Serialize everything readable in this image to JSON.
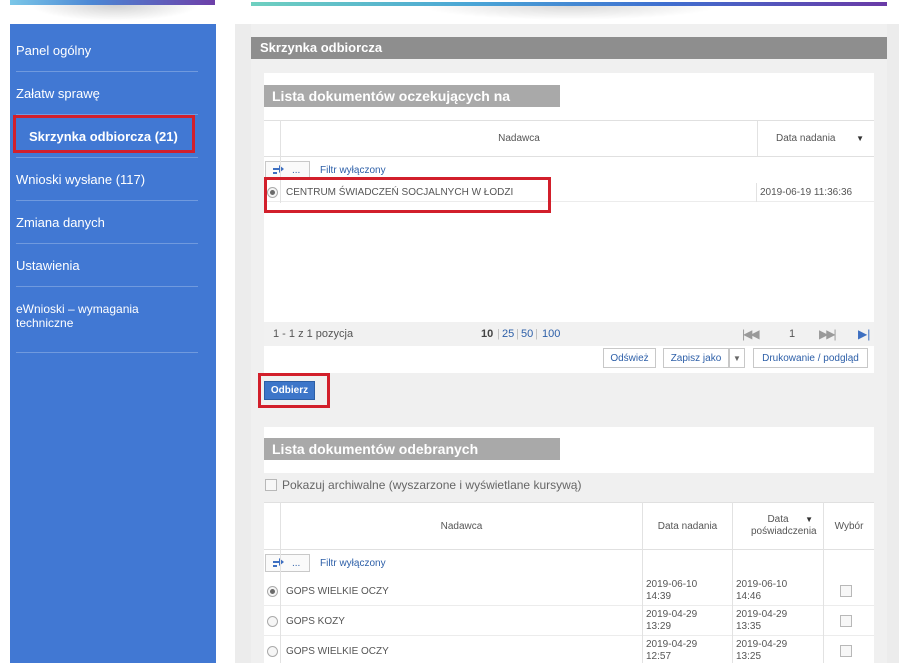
{
  "sidebar": {
    "items": [
      {
        "label": "Panel ogólny"
      },
      {
        "label": "Załatw sprawę"
      },
      {
        "label": "Skrzynka odbiorcza (21)"
      },
      {
        "label": "Wnioski wysłane (117)"
      },
      {
        "label": "Zmiana danych"
      },
      {
        "label": "Ustawienia"
      },
      {
        "label": "eWnioski – wymagania techniczne"
      }
    ]
  },
  "page": {
    "title": "Skrzynka odbiorcza"
  },
  "pending": {
    "title": "Lista dokumentów oczekujących na odbiór",
    "columns": {
      "sender": "Nadawca",
      "date": "Data nadania"
    },
    "filter_label": "Filtr wyłączony",
    "filter_button": "...",
    "rows": [
      {
        "sender": "CENTRUM ŚWIADCZEŃ SOCJALNYCH W ŁODZI",
        "date": "2019-06-19 11:36:36",
        "selected": true
      }
    ],
    "pager": {
      "summary": "1 - 1 z 1 pozycja",
      "sizes": [
        "10",
        "25",
        "50",
        "100"
      ],
      "current_page": "1"
    },
    "actions": {
      "refresh": "Odśwież",
      "save_as": "Zapisz jako",
      "print": "Drukowanie / podgląd"
    },
    "receive_button": "Odbierz"
  },
  "received": {
    "title": "Lista dokumentów odebranych",
    "archive_checkbox_label": "Pokazuj archiwalne (wyszarzone i wyświetlane kursywą)",
    "columns": {
      "sender": "Nadawca",
      "date": "Data nadania",
      "confirm_date": "Data poświadczenia",
      "select": "Wybór"
    },
    "filter_label": "Filtr wyłączony",
    "filter_button": "...",
    "rows": [
      {
        "sender": "GOPS WIELKIE OCZY",
        "date": "2019-06-10 14:39",
        "confirm": "2019-06-10 14:46",
        "selected": true
      },
      {
        "sender": "GOPS KOZY",
        "date": "2019-04-29 13:29",
        "confirm": "2019-04-29 13:35",
        "selected": false
      },
      {
        "sender": "GOPS WIELKIE OCZY",
        "date": "2019-04-29 12:57",
        "confirm": "2019-04-29 13:25",
        "selected": false
      }
    ]
  },
  "colors": {
    "sidebar": "#4178d3",
    "highlight": "#d21f2b",
    "section_header": "#8e8e8e",
    "panel_header": "#a9a9a9",
    "link": "#2d5fa8"
  }
}
